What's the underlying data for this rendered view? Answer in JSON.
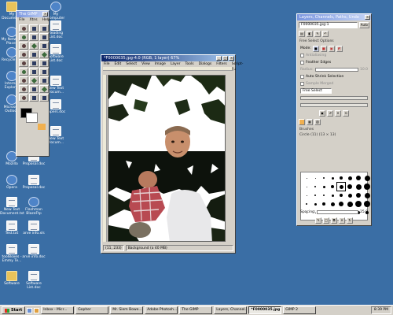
{
  "desktop": {
    "icons": [
      {
        "label": "My Documents",
        "type": "folder"
      },
      {
        "label": "My Computer",
        "type": "app"
      },
      {
        "label": "My Network Places",
        "type": "app"
      },
      {
        "label": "Reading List.doc",
        "type": "doc"
      },
      {
        "label": "Recycle Bin",
        "type": "app"
      },
      {
        "label": "Software List.doc",
        "type": "doc"
      },
      {
        "label": "Internet Explorer",
        "type": "app"
      },
      {
        "label": "New Text Docum...",
        "type": "doc"
      },
      {
        "label": "Microsoft Outlook",
        "type": "app"
      },
      {
        "label": "Papers.doc",
        "type": "doc"
      },
      {
        "label": "New Text Docum...",
        "type": "doc"
      },
      {
        "label": "Mozilla",
        "type": "app"
      },
      {
        "label": "Proposal.doc",
        "type": "doc"
      },
      {
        "label": "Opera",
        "type": "app"
      },
      {
        "label": "Proposal.doc",
        "type": "doc"
      },
      {
        "label": "New Text Document.txt",
        "type": "doc"
      },
      {
        "label": "Flashman BlazeFtp",
        "type": "app"
      },
      {
        "label": "Test.txt",
        "type": "doc"
      },
      {
        "label": "arve info.xls",
        "type": "doc"
      },
      {
        "label": "toolBoxes - Emmy Te...",
        "type": "doc"
      },
      {
        "label": "arve info.doc",
        "type": "doc"
      },
      {
        "label": "Software",
        "type": "folder"
      },
      {
        "label": "Software List.doc",
        "type": "doc"
      }
    ]
  },
  "toolbox": {
    "title": "The GIMP",
    "menus": [
      "File",
      "Xtns",
      "Help"
    ],
    "tool_count": 27
  },
  "image_window": {
    "title": "*F0000035.jpg-4.0 (RGB, 1 layer) 67%",
    "menus": [
      "File",
      "Edit",
      "Select",
      "View",
      "Image",
      "Layer",
      "Tools",
      "Dialogs",
      "Filters",
      "Script-Fu"
    ],
    "status_coords": "(11, 233)",
    "status_text": "Background (a 40 MB)"
  },
  "layers_dialog": {
    "title": "Layers, Channels, Paths, Undo",
    "image_select": "F0000035.jpg-1",
    "auto_label": "Auto",
    "options_title": "Free Select Options",
    "mode_label": "Mode:",
    "antialias_label": "Antialiasing",
    "feather_label": "Feather Edges",
    "radius_label": "Radius:",
    "radius_value": "10.0",
    "autoshrink_label": "Auto Shrink Selection",
    "sample_merged_label": "Sample Merged",
    "free_select_label": "Free Select",
    "brushes_title": "Brushes",
    "brush_name": "Circle (11) (13 × 13)",
    "spacing_label": "Spacing:",
    "spacing_value": "25.0"
  },
  "taskbar": {
    "start_label": "Start",
    "tasks": [
      {
        "label": "Inbox - Micr...",
        "active": false
      },
      {
        "label": "Gopher",
        "active": false
      },
      {
        "label": "Mr. Siem Bowe...",
        "active": false
      },
      {
        "label": "Adobe Photosh...",
        "active": false
      },
      {
        "label": "The GIMP",
        "active": false
      },
      {
        "label": "Layers, Channel...",
        "active": false
      },
      {
        "label": "*F0000035.jpg",
        "active": true
      },
      {
        "label": "GIMP 2",
        "active": false
      }
    ],
    "clock": "8:39 PM"
  }
}
